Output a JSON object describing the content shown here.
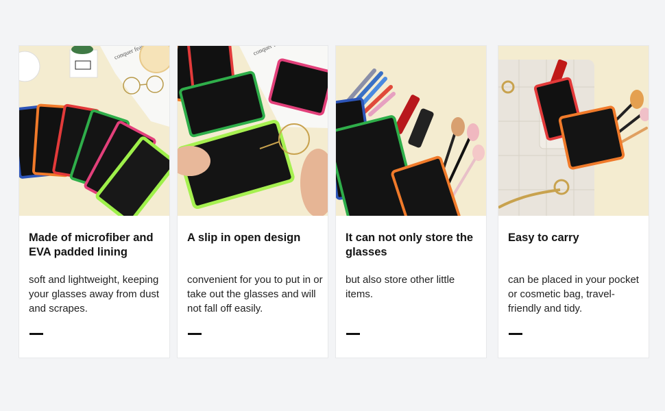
{
  "cards": [
    {
      "title": "Made of microfiber and EVA padded lining",
      "description": "soft and lightweight, keeping your glasses away from dust and scrapes."
    },
    {
      "title": "A slip in open design",
      "description": "convenient for you to put in or take out the glasses and will not fall off easily."
    },
    {
      "title": "It can not only store the glasses",
      "description": "but also store other little items."
    },
    {
      "title": "Easy to carry",
      "description": "can be placed in your pocket or cosmetic bag, travel-friendly and tidy."
    }
  ],
  "photos": [
    {
      "subject": "row of black sleeves with colored trims, glasses and note paper",
      "trim_colors": [
        "#2d55b8",
        "#f07a2a",
        "#e23a3a",
        "#2fae4a",
        "#e2407a",
        "#9ef04a"
      ]
    },
    {
      "subject": "hands sliding glasses into an open sleeve",
      "trim_colors": [
        "#f07a2a",
        "#e23a3a",
        "#2fae4a",
        "#e2407a",
        "#a6f050"
      ]
    },
    {
      "subject": "sleeves holding pencils, lipstick and makeup brushes",
      "trim_colors": [
        "#2d55b8",
        "#2fae4a",
        "#f07a2a"
      ]
    },
    {
      "subject": "white handbag with sleeves holding lipstick and brushes",
      "trim_colors": [
        "#e23a3a",
        "#f07a2a"
      ]
    }
  ],
  "colors": {
    "background": "#f3f4f6",
    "card": "#ffffff",
    "text": "#141414"
  }
}
